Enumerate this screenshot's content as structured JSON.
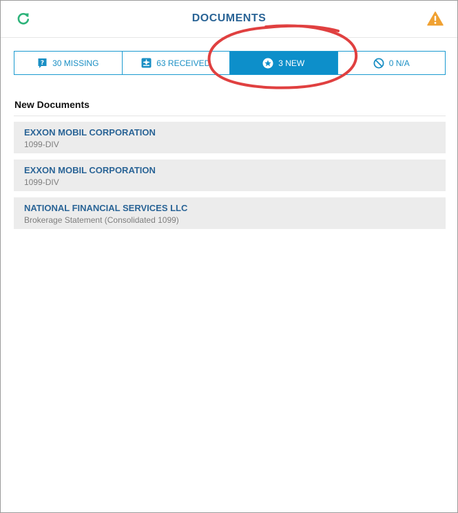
{
  "header": {
    "title": "DOCUMENTS",
    "refresh_icon": "refresh-icon",
    "warning_icon": "warning-icon",
    "refresh_color": "#2db37a",
    "warning_color": "#f0a132",
    "title_color": "#2a6496"
  },
  "tabs": [
    {
      "label": "30 MISSING",
      "icon": "question-icon",
      "active": false
    },
    {
      "label": "63 RECEIVED",
      "icon": "inbox-icon",
      "active": false
    },
    {
      "label": "3 NEW",
      "icon": "star-icon",
      "active": true
    },
    {
      "label": "0 N/A",
      "icon": "ban-icon",
      "active": false
    }
  ],
  "accent_color": "#0d8fca",
  "section": {
    "title": "New Documents"
  },
  "documents": [
    {
      "name": "EXXON MOBIL CORPORATION",
      "type": "1099-DIV"
    },
    {
      "name": "EXXON MOBIL CORPORATION",
      "type": "1099-DIV"
    },
    {
      "name": "NATIONAL FINANCIAL SERVICES LLC",
      "type": "Brokerage Statement (Consolidated 1099)"
    }
  ],
  "annotation": {
    "color": "#e04040",
    "shape": "hand-drawn circle around active tab"
  }
}
